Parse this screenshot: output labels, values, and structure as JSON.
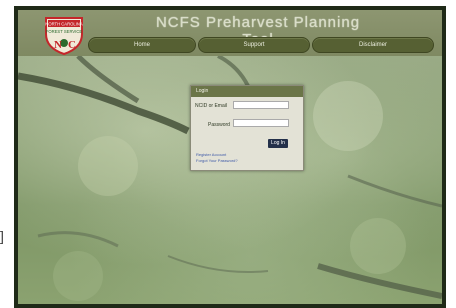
{
  "header": {
    "site_title": "NCFS Preharvest Planning Tool",
    "logo": {
      "text_top": "NORTH CAROLINA",
      "text_mid": "FOREST SERVICE",
      "text_bottom": "NC",
      "icon": "ncfs-shield-logo",
      "colors": {
        "red": "#c4262a",
        "green": "#2c6a2e"
      }
    }
  },
  "nav": {
    "home": "Home",
    "support": "Support",
    "disclaimer": "Disclaimer"
  },
  "login": {
    "title": "Login",
    "user_label": "NCID or Email",
    "password_label": "Password",
    "button": "Log In",
    "register_link": "Register Account",
    "forgot_link": "Forgot Your Password?"
  },
  "colors": {
    "header_bg": "#858f69",
    "nav_button": "#566033",
    "login_button": "#24304a"
  }
}
